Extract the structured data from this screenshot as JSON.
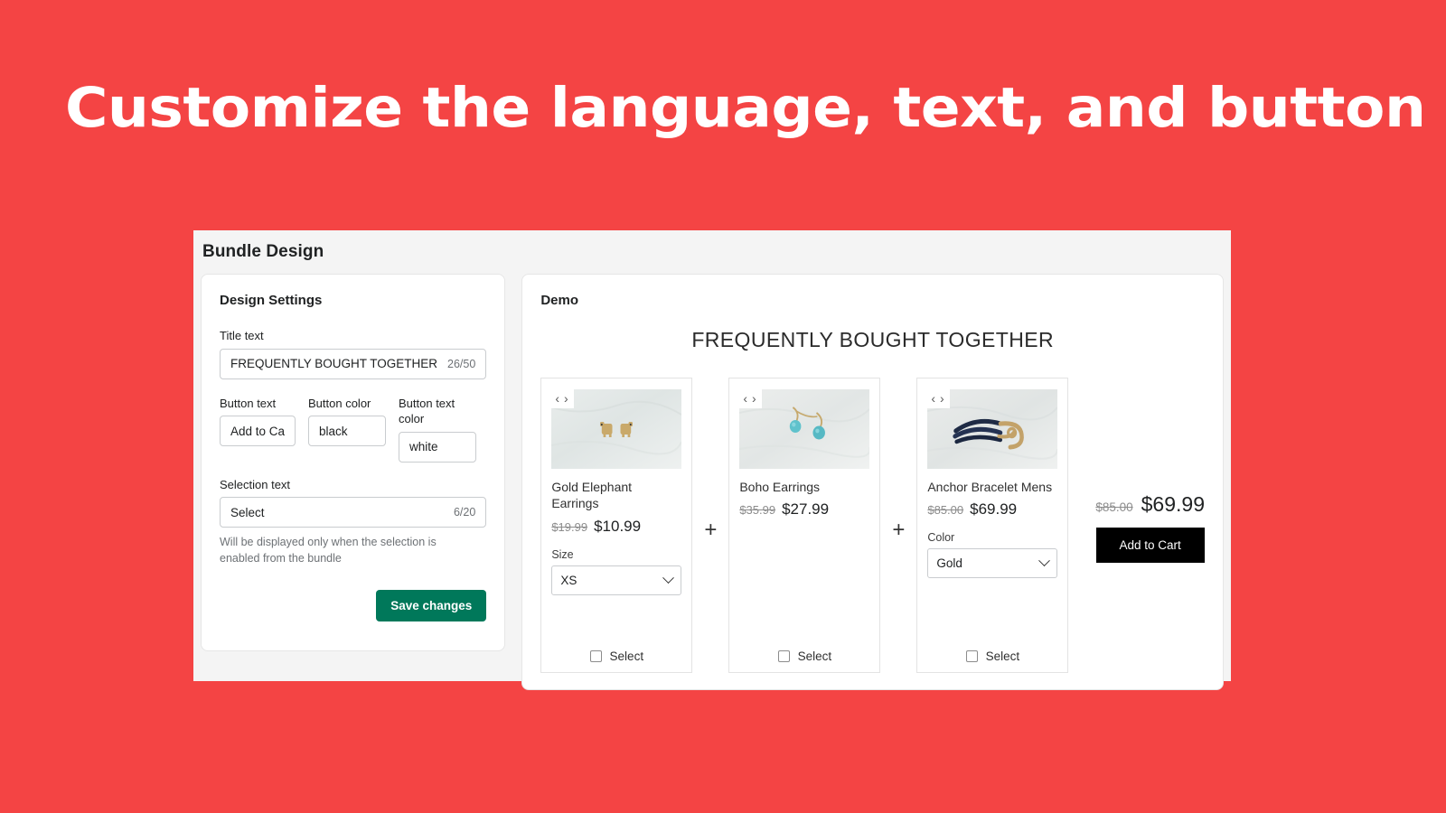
{
  "banner": {
    "headline": "Customize the language, text, and button",
    "background_color": "#f44444",
    "text_color": "#ffffff"
  },
  "app": {
    "title": "Bundle Design"
  },
  "settings": {
    "heading": "Design Settings",
    "title_text": {
      "label": "Title text",
      "value": "FREQUENTLY BOUGHT TOGETHER",
      "counter": "26/50"
    },
    "button_text": {
      "label": "Button text",
      "value": "Add to Cart"
    },
    "button_color": {
      "label": "Button color",
      "value": "black"
    },
    "button_text_color": {
      "label": "Button text color",
      "value": "white"
    },
    "selection_text": {
      "label": "Selection text",
      "value": "Select",
      "counter": "6/20",
      "helper": "Will be displayed only when the selection is enabled from the bundle"
    },
    "save_label": "Save changes",
    "save_color": "#00785a"
  },
  "demo": {
    "heading": "Demo",
    "bundle_title": "FREQUENTLY BOUGHT TOGETHER",
    "plus_symbol": "+",
    "prev_icon": "‹",
    "next_icon": "›",
    "products": [
      {
        "name": "Gold Elephant Earrings",
        "price_old": "$19.99",
        "price_new": "$10.99",
        "variant_label": "Size",
        "variant_value": "XS",
        "select_label": "Select"
      },
      {
        "name": "Boho Earrings",
        "price_old": "$35.99",
        "price_new": "$27.99",
        "variant_label": "",
        "variant_value": "",
        "select_label": "Select"
      },
      {
        "name": "Anchor Bracelet Mens",
        "price_old": "$85.00",
        "price_new": "$69.99",
        "variant_label": "Color",
        "variant_value": "Gold",
        "select_label": "Select"
      }
    ],
    "total": {
      "price_old": "$85.00",
      "price_new": "$69.99",
      "add_to_cart_label": "Add to Cart",
      "button_color": "#000000",
      "button_text_color": "#ffffff"
    }
  }
}
